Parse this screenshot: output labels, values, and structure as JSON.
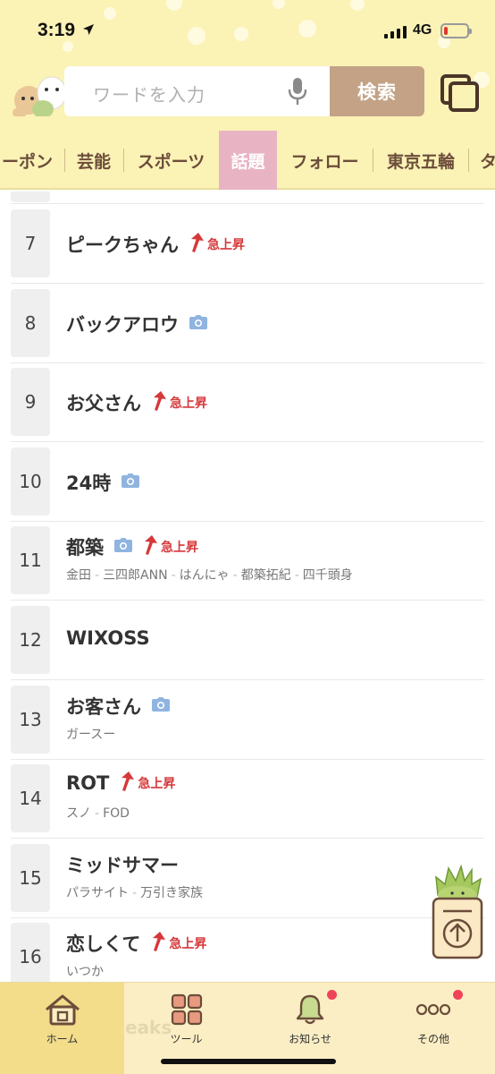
{
  "status_bar": {
    "time": "3:19",
    "network": "4G",
    "battery_level": 0.15
  },
  "search": {
    "placeholder": "ワードを入力",
    "button_label": "検索"
  },
  "categories": [
    {
      "label": "ーポン",
      "active": false
    },
    {
      "label": "芸能",
      "active": false
    },
    {
      "label": "スポーツ",
      "active": false
    },
    {
      "label": "話題",
      "active": true
    },
    {
      "label": "フォロー",
      "active": false
    },
    {
      "label": "東京五輪",
      "active": false
    },
    {
      "label": "タ",
      "active": false
    }
  ],
  "ranking": [
    {
      "rank": "7",
      "title": "ピークちゃん",
      "camera": false,
      "rising": true,
      "related": []
    },
    {
      "rank": "8",
      "title": "バックアロウ",
      "camera": true,
      "rising": false,
      "related": []
    },
    {
      "rank": "9",
      "title": "お父さん",
      "camera": false,
      "rising": true,
      "related": []
    },
    {
      "rank": "10",
      "title": "24時",
      "camera": true,
      "rising": false,
      "related": []
    },
    {
      "rank": "11",
      "title": "都築",
      "camera": true,
      "rising": true,
      "related": [
        "金田",
        "三四郎ANN",
        "はんにゃ",
        "都築拓紀",
        "四千頭身"
      ]
    },
    {
      "rank": "12",
      "title": "WIXOSS",
      "camera": false,
      "rising": false,
      "related": []
    },
    {
      "rank": "13",
      "title": "お客さん",
      "camera": true,
      "rising": false,
      "related": [
        "ガースー"
      ]
    },
    {
      "rank": "14",
      "title": "ROT",
      "camera": false,
      "rising": true,
      "related": [
        "スノ",
        "FOD"
      ]
    },
    {
      "rank": "15",
      "title": "ミッドサマー",
      "camera": false,
      "rising": false,
      "related": [
        "パラサイト",
        "万引き家族"
      ]
    },
    {
      "rank": "16",
      "title": "恋しくて",
      "camera": false,
      "rising": true,
      "related": [
        "いつか"
      ]
    }
  ],
  "rising_label": "急上昇",
  "bottom_nav": [
    {
      "label": "ホーム",
      "icon": "home-icon",
      "active": true,
      "badge": false
    },
    {
      "label": "ツール",
      "icon": "tools-icon",
      "active": false,
      "badge": false
    },
    {
      "label": "お知らせ",
      "icon": "bell-icon",
      "active": false,
      "badge": true
    },
    {
      "label": "その他",
      "icon": "more-icon",
      "active": false,
      "badge": true
    }
  ],
  "colors": {
    "header_bg": "#fbf2b6",
    "active_tab": "#e8b4c4",
    "search_button": "#c3a286",
    "rising_red": "#d6383a",
    "camera_blue": "#8fb4e0",
    "badge": "#f0435a"
  }
}
